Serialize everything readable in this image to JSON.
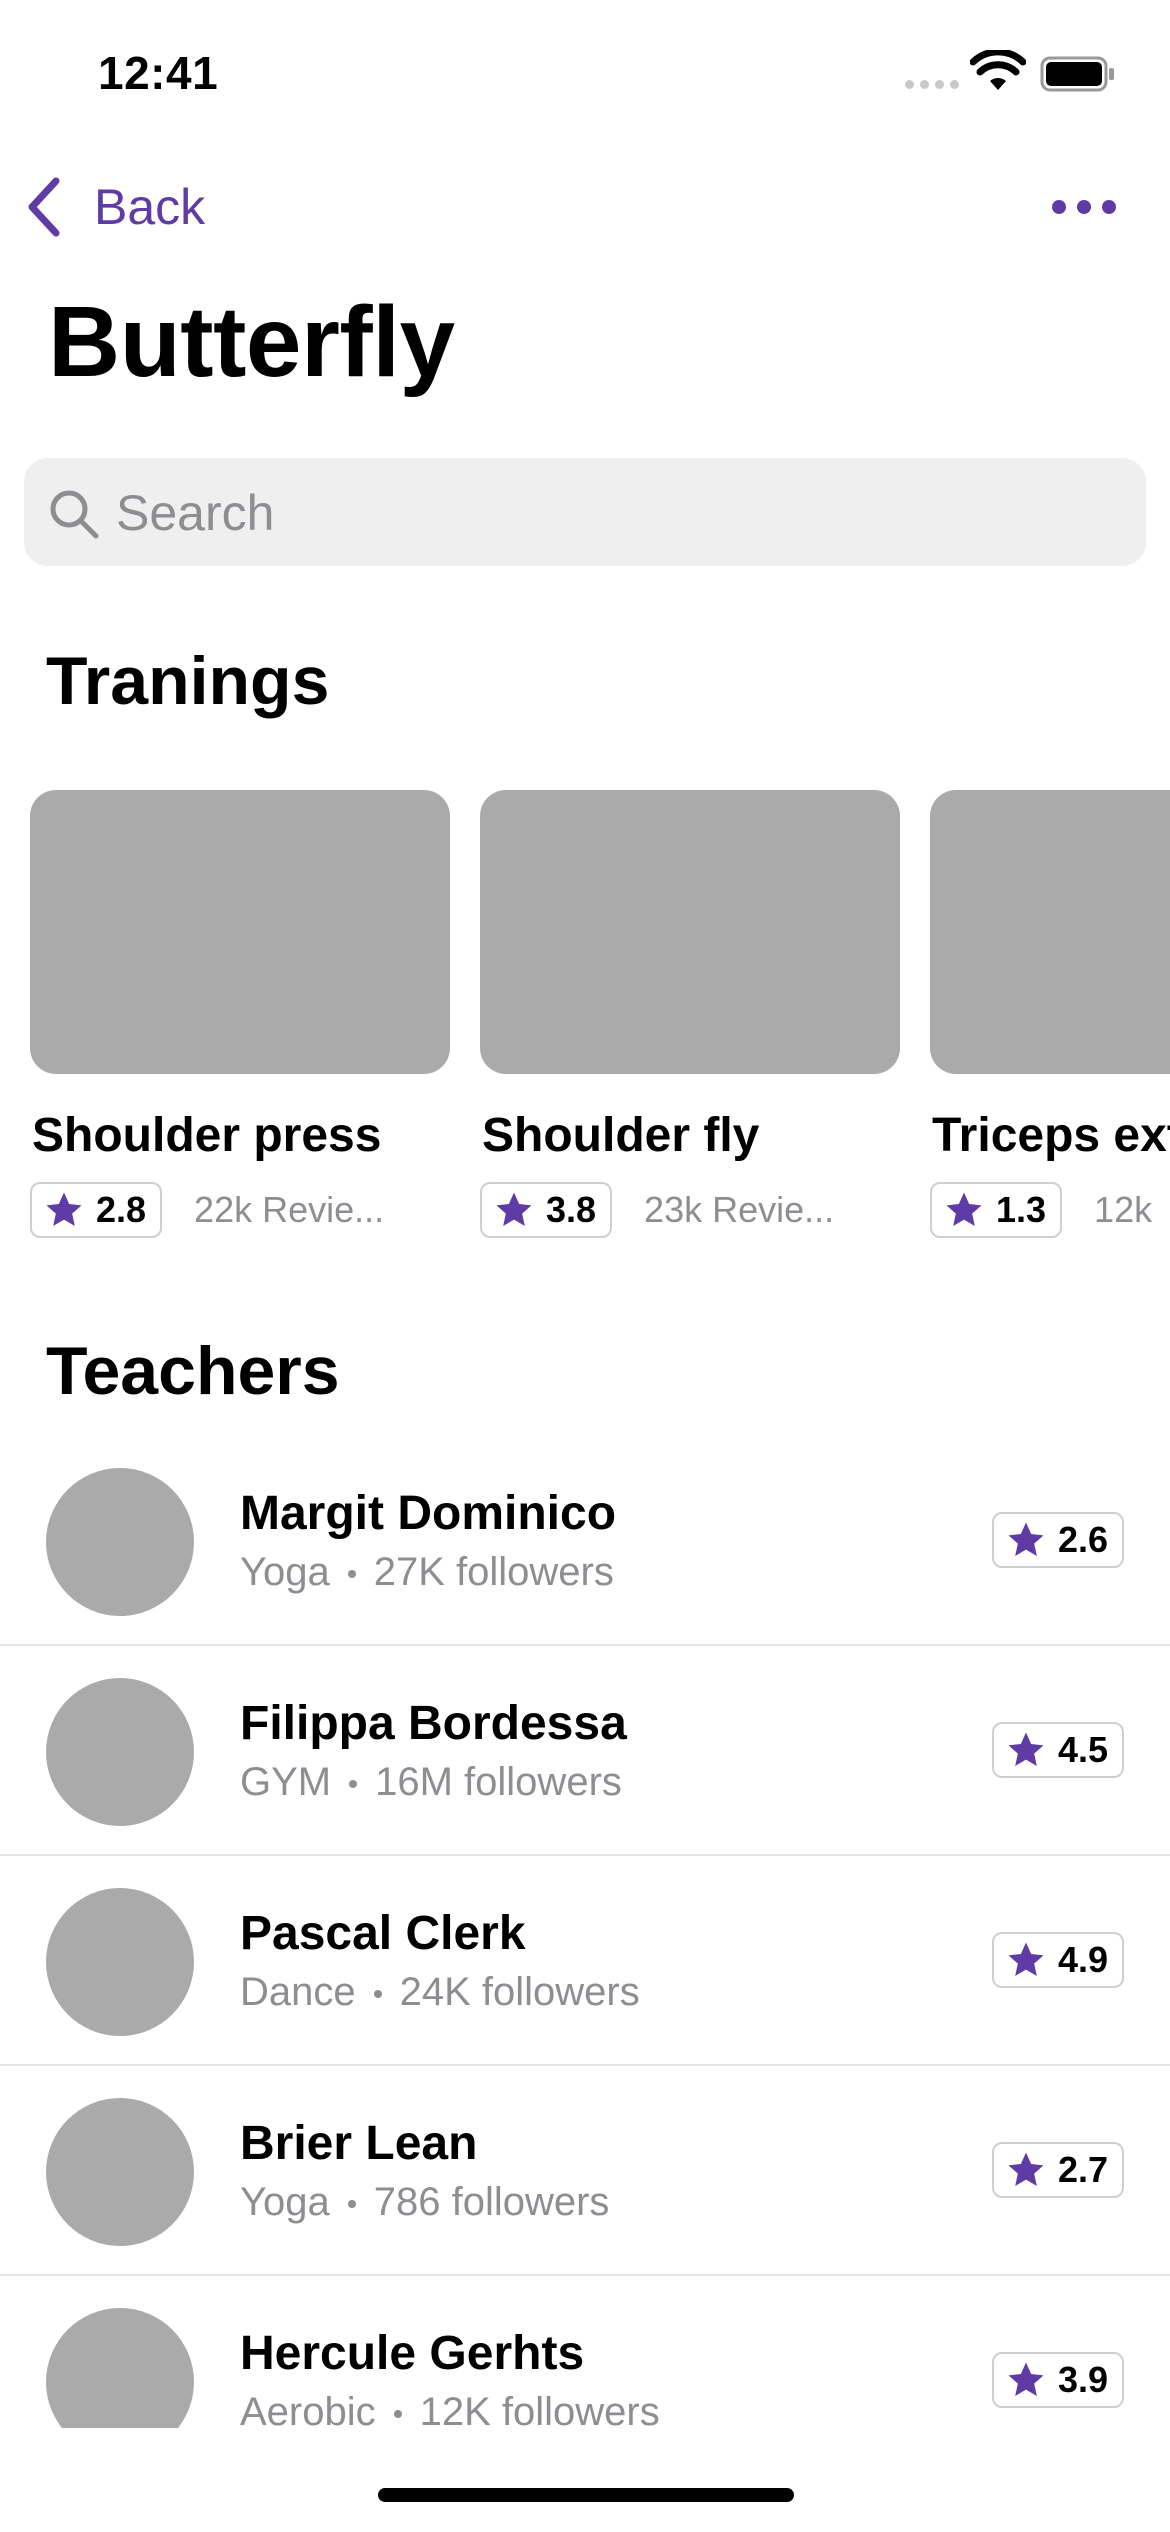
{
  "status_bar": {
    "time": "12:41"
  },
  "nav": {
    "back_label": "Back"
  },
  "page": {
    "title": "Butterfly"
  },
  "search": {
    "placeholder": "Search"
  },
  "sections": {
    "trainings": "Tranings",
    "teachers": "Teachers"
  },
  "colors": {
    "accent": "#5f3ca5",
    "placeholder_gray": "#aaaaaa",
    "secondary_text": "#8e8e92"
  },
  "trainings": [
    {
      "name": "Shoulder press",
      "rating": "2.8",
      "reviews": "22k Revie..."
    },
    {
      "name": "Shoulder fly",
      "rating": "3.8",
      "reviews": "23k Revie..."
    },
    {
      "name": "Triceps ext",
      "rating": "1.3",
      "reviews": "12k"
    }
  ],
  "teachers": [
    {
      "name": "Margit Dominico",
      "category": "Yoga",
      "followers": "27K followers",
      "rating": "2.6"
    },
    {
      "name": "Filippa Bordessa",
      "category": "GYM",
      "followers": "16M followers",
      "rating": "4.5"
    },
    {
      "name": "Pascal Clerk",
      "category": "Dance",
      "followers": "24K followers",
      "rating": "4.9"
    },
    {
      "name": "Brier Lean",
      "category": "Yoga",
      "followers": "786 followers",
      "rating": "2.7"
    },
    {
      "name": "Hercule Gerhts",
      "category": "Aerobic",
      "followers": "12K followers",
      "rating": "3.9"
    }
  ]
}
